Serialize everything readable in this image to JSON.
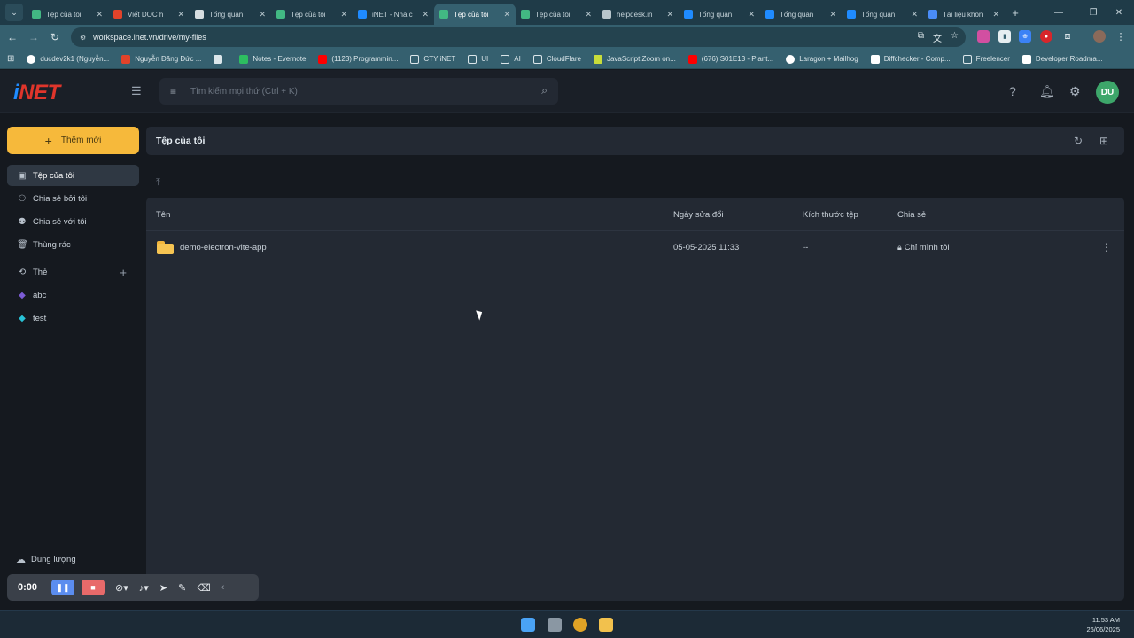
{
  "browser": {
    "tabs": [
      {
        "label": "Tệp của tôi",
        "icon": "vue-icon",
        "color": "#42b883",
        "active": false
      },
      {
        "label": "Viết DOC h",
        "icon": "gitlab-icon",
        "color": "#e2432a",
        "active": false
      },
      {
        "label": "Tổng quan",
        "icon": "chatgpt-icon",
        "color": "#d6dde0",
        "active": false
      },
      {
        "label": "Tệp của tôi",
        "icon": "vue-icon",
        "color": "#42b883",
        "active": false
      },
      {
        "label": "iNET - Nhà c",
        "icon": "inet-icon",
        "color": "#1f8bff",
        "active": false
      },
      {
        "label": "Tệp của tôi",
        "icon": "vue-icon",
        "color": "#42b883",
        "active": true
      },
      {
        "label": "Tệp của tôi",
        "icon": "vue-icon",
        "color": "#42b883",
        "active": false
      },
      {
        "label": "helpdesk.in",
        "icon": "globe-icon",
        "color": "#b8c6cc",
        "active": false
      },
      {
        "label": "Tổng quan",
        "icon": "inet-icon",
        "color": "#1f8bff",
        "active": false
      },
      {
        "label": "Tổng quan",
        "icon": "inet-icon",
        "color": "#1f8bff",
        "active": false
      },
      {
        "label": "Tổng quan",
        "icon": "inet-icon",
        "color": "#1f8bff",
        "active": false
      },
      {
        "label": "Tài liệu khôn",
        "icon": "docs-icon",
        "color": "#4a8cf7",
        "active": false
      }
    ],
    "url": "workspace.inet.vn/drive/my-files",
    "bookmarks": [
      {
        "label": "ducdev2k1 (Nguyễn...",
        "icon": "github-icon",
        "color": "#ffffff"
      },
      {
        "label": "Nguyễn Đăng Đức ...",
        "icon": "gitlab-icon",
        "color": "#e2432a"
      },
      {
        "label": "",
        "icon": "globe-icon",
        "color": "#dbe6ea"
      },
      {
        "label": "Notes - Evernote",
        "icon": "evernote-icon",
        "color": "#2dbe60"
      },
      {
        "label": "(1123) Programmin...",
        "icon": "youtube-icon",
        "color": "#ff0000"
      },
      {
        "label": "CTY iNET",
        "icon": "folder-icon",
        "color": "#dbe6ea"
      },
      {
        "label": "UI",
        "icon": "folder-icon",
        "color": "#dbe6ea"
      },
      {
        "label": "AI",
        "icon": "folder-icon",
        "color": "#dbe6ea"
      },
      {
        "label": "CloudFlare",
        "icon": "folder-icon",
        "color": "#dbe6ea"
      },
      {
        "label": "JavaScript Zoom on...",
        "icon": "js-icon",
        "color": "#c9dd3a"
      },
      {
        "label": "(676) S01E13 - Plant...",
        "icon": "youtube-icon",
        "color": "#ff0000"
      },
      {
        "label": "Laragon + Mailhog",
        "icon": "github-icon",
        "color": "#ffffff"
      },
      {
        "label": "Diffchecker - Comp...",
        "icon": "diffchecker-icon",
        "color": "#ffffff"
      },
      {
        "label": "Freelencer",
        "icon": "folder-icon",
        "color": "#dbe6ea"
      },
      {
        "label": "Developer Roadma...",
        "icon": "roadmap-icon",
        "color": "#ffffff"
      }
    ]
  },
  "app": {
    "search_placeholder": "Tìm kiếm mọi thứ (Ctrl + K)",
    "avatar_initials": "DU",
    "avatar_color": "#3da66a",
    "new_button": "Thêm mới",
    "sidebar": {
      "items": [
        {
          "label": "Tệp của tôi",
          "icon": "my-files-icon",
          "active": true
        },
        {
          "label": "Chia sẻ bởi tôi",
          "icon": "share-by-me-icon",
          "active": false
        },
        {
          "label": "Chia sẻ với tôi",
          "icon": "shared-with-me-icon",
          "active": false
        },
        {
          "label": "Thùng rác",
          "icon": "trash-icon",
          "active": false
        }
      ],
      "tags_label": "Thẻ",
      "tags": [
        {
          "label": "abc",
          "color": "#7c5cd6"
        },
        {
          "label": "test",
          "color": "#28c2d6"
        }
      ],
      "storage_label": "Dung lượng"
    },
    "main": {
      "title": "Tệp của tôi",
      "columns": [
        "Tên",
        "Ngày sửa đổi",
        "Kích thước tệp",
        "Chia sẻ"
      ],
      "rows": [
        {
          "name": "demo-electron-vite-app",
          "modified": "05-05-2025 11:33",
          "size": "--",
          "share": "Chỉ mình tôi"
        }
      ]
    }
  },
  "recorder": {
    "time": "0:00"
  },
  "taskbar": {
    "time": "11:53 AM",
    "date": "26/06/2025"
  },
  "colors": {
    "accent": "#f6b93b",
    "logo_blue": "#1f8bff",
    "logo_red": "#e0352b"
  }
}
